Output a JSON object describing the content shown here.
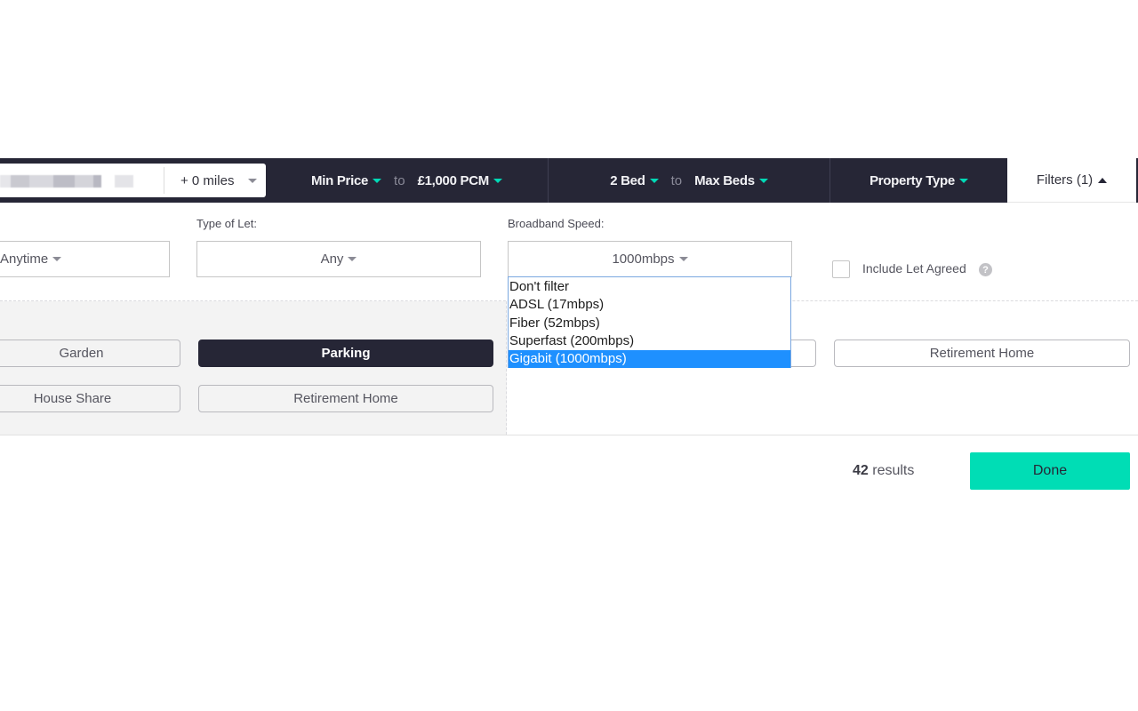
{
  "search_bar": {
    "location_value": "(pixelated location)",
    "radius": "+ 0 miles",
    "min_price": "Min Price",
    "to_label": "to",
    "max_price": "£1,000 PCM",
    "min_beds": "2 Bed",
    "max_beds": "Max Beds",
    "property_type": "Property Type",
    "filters_button": "Filters (1)"
  },
  "filters": {
    "available_from": {
      "label": "",
      "value": "Anytime"
    },
    "type_of_let": {
      "label": "Type of Let:",
      "value": "Any"
    },
    "broadband_speed": {
      "label": "Broadband Speed:",
      "value": "1000mbps",
      "options": [
        {
          "label": "Don't filter",
          "selected": false
        },
        {
          "label": "ADSL (17mbps)",
          "selected": false
        },
        {
          "label": "Fiber (52mbps)",
          "selected": false
        },
        {
          "label": "Superfast (200mbps)",
          "selected": false
        },
        {
          "label": "Gigabit (1000mbps)",
          "selected": true
        }
      ]
    },
    "include_let_agreed": {
      "label": "Include Let Agreed",
      "checked": false,
      "help": "?"
    },
    "features_left": [
      {
        "label": "Garden",
        "active": false
      },
      {
        "label": "Parking",
        "active": true
      },
      {
        "label": "House Share",
        "active": false
      },
      {
        "label": "Retirement Home",
        "active": false
      }
    ],
    "features_right": [
      {
        "label": "Retirement Home",
        "active": false
      }
    ]
  },
  "footer": {
    "results_count": "42",
    "results_label": " results",
    "done_button": "Done"
  },
  "colors": {
    "bar_background": "#262636",
    "accent_teal": "#00ddb5",
    "selected_option": "#1e90ff"
  }
}
